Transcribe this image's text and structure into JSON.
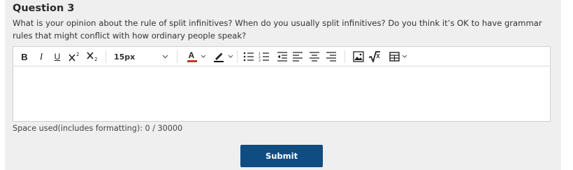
{
  "question": {
    "title": "Question 3",
    "text": "What is your opinion about the rule of split infinitives? When do you usually split infinitives? Do you think it’s OK to have grammar rules that might conflict with how ordinary people speak?"
  },
  "toolbar": {
    "bold_label": "B",
    "italic_label": "I",
    "underline_label": "U",
    "font_size_value": "15px",
    "font_color_label": "A"
  },
  "editor": {
    "content": ""
  },
  "usage": {
    "text": "Space used(includes formatting): 0 / 30000"
  },
  "submit": {
    "label": "Submit"
  },
  "colors": {
    "panel_bg": "#efefef",
    "submit_bg": "#0f4c81",
    "font_color_underline": "#c0392b"
  }
}
